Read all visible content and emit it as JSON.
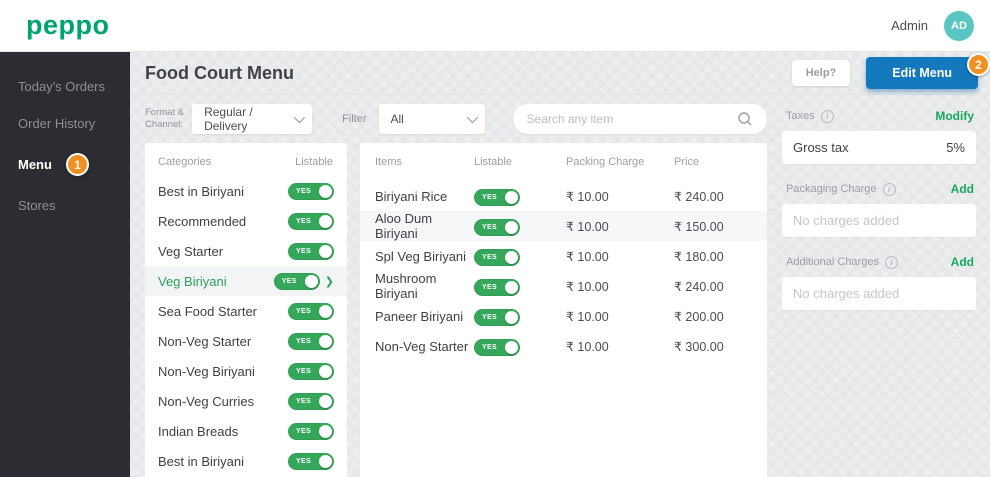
{
  "topbar": {
    "logo": "peppo",
    "user_label": "Admin",
    "avatar_initials": "AD"
  },
  "sidebar": {
    "items": [
      {
        "label": "Today's Orders"
      },
      {
        "label": "Order History"
      },
      {
        "label": "Menu",
        "badge": "1"
      },
      {
        "label": "Stores"
      }
    ]
  },
  "header": {
    "title": "Food Court Menu",
    "help_label": "Help?",
    "edit_menu_label": "Edit Menu",
    "edit_menu_badge": "2"
  },
  "filters": {
    "format_channel_label": "Format &\nChannel:",
    "format_channel_value": "Regular / Delivery",
    "filter_label": "Filter",
    "filter_value": "All",
    "search_placeholder": "Search any item"
  },
  "labels": {
    "yes": "YES"
  },
  "icons": {
    "chevron_right": "❯",
    "info": "i"
  },
  "categories": {
    "header_name": "Categories",
    "header_listable": "Listable",
    "items": [
      {
        "name": "Best in Biriyani"
      },
      {
        "name": "Recommended"
      },
      {
        "name": "Veg Starter"
      },
      {
        "name": "Veg Biriyani",
        "selected": true
      },
      {
        "name": "Sea Food Starter"
      },
      {
        "name": "Non-Veg Starter"
      },
      {
        "name": "Non-Veg Biriyani"
      },
      {
        "name": "Non-Veg  Curries"
      },
      {
        "name": "Indian Breads"
      },
      {
        "name": "Best in Biriyani"
      }
    ]
  },
  "items_table": {
    "headers": {
      "items": "Items",
      "listable": "Listable",
      "packing_charge": "Packing Charge",
      "price": "Price"
    },
    "rows": [
      {
        "name": "Biriyani Rice",
        "packing_charge": "₹ 10.00",
        "price": "₹ 240.00"
      },
      {
        "name": "Aloo Dum Biriyani",
        "packing_charge": "₹ 10.00",
        "price": "₹ 150.00"
      },
      {
        "name": "Spl Veg Biriyani",
        "packing_charge": "₹ 10.00",
        "price": "₹ 180.00"
      },
      {
        "name": "Mushroom Biriyani",
        "packing_charge": "₹ 10.00",
        "price": "₹ 240.00"
      },
      {
        "name": "Paneer Biriyani",
        "packing_charge": "₹ 10.00",
        "price": "₹ 200.00"
      },
      {
        "name": "Non-Veg Starter",
        "packing_charge": "₹ 10.00",
        "price": "₹ 300.00"
      }
    ]
  },
  "charges_panel": {
    "taxes": {
      "label": "Taxes",
      "action": "Modify",
      "row_name": "Gross tax",
      "row_value": "5%"
    },
    "packaging": {
      "label": "Packaging Charge",
      "action": "Add",
      "empty_text": "No charges added"
    },
    "additional": {
      "label": "Additional Charges",
      "action": "Add",
      "empty_text": "No charges added"
    }
  },
  "colors": {
    "brand_green": "#00a46e",
    "toggle_green": "#35a75a",
    "action_green": "#18a85b",
    "primary_blue": "#1478bd",
    "badge_orange": "#ef9121",
    "avatar_teal": "#5ac6c3",
    "sidebar_bg": "#2b2d32"
  }
}
